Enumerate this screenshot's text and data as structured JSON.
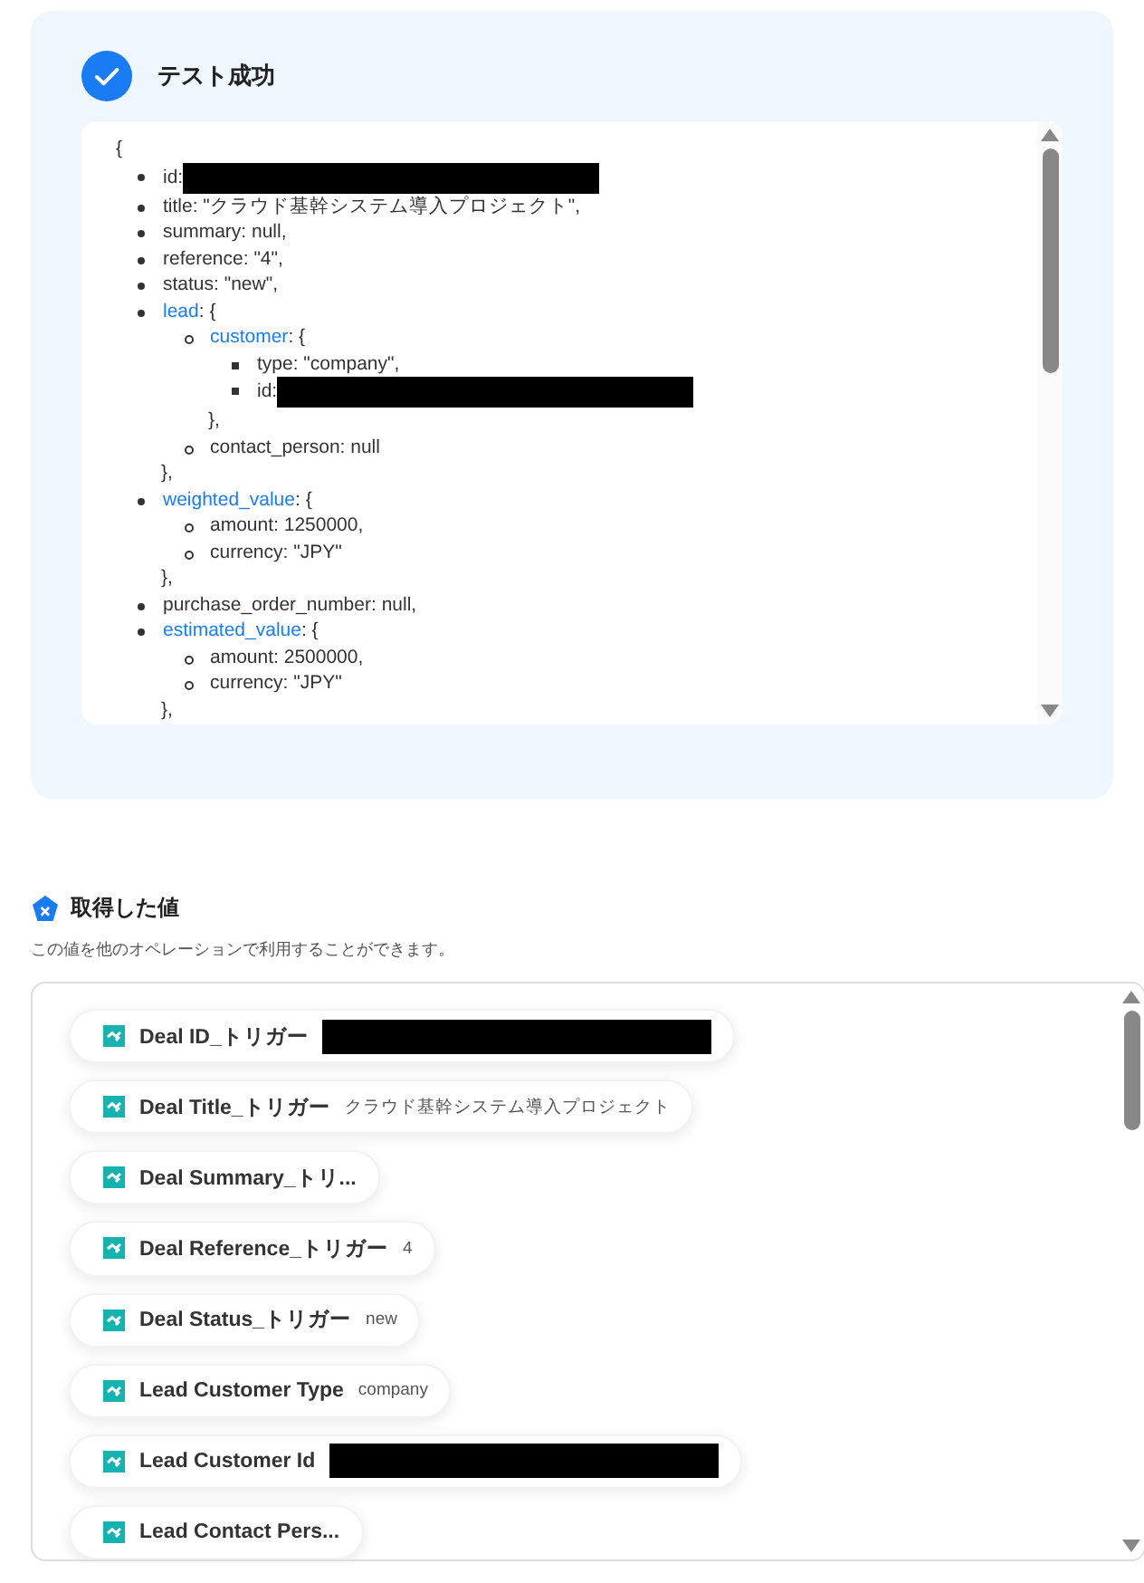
{
  "test_result": {
    "title": "テスト成功",
    "code": {
      "open": "{",
      "items": [
        {
          "label": "id:",
          "redacted": true
        },
        {
          "label": "title: \"クラウド基幹システム導入プロジェクト\","
        },
        {
          "label": "summary: null,"
        },
        {
          "label": "reference: \"4\","
        },
        {
          "label": "status: \"new\","
        },
        {
          "key": "lead",
          "suffix": ": {",
          "close": "},",
          "children": [
            {
              "key": "customer",
              "suffix": ": {",
              "close": "},",
              "children": [
                {
                  "label": "type: \"company\","
                },
                {
                  "label": "id:",
                  "redacted": true
                }
              ]
            },
            {
              "label": "contact_person: null"
            }
          ]
        },
        {
          "key": "weighted_value",
          "suffix": ": {",
          "close": "},",
          "children": [
            {
              "label": "amount: 1250000,"
            },
            {
              "label": "currency: \"JPY\""
            }
          ]
        },
        {
          "label": "purchase_order_number: null,"
        },
        {
          "key": "estimated_value",
          "suffix": ": {",
          "close": "},",
          "children": [
            {
              "label": "amount: 2500000,"
            },
            {
              "label": "currency: \"JPY\""
            }
          ]
        }
      ]
    }
  },
  "values": {
    "title": "取得した値",
    "description": "この値を他のオペレーションで利用することができます。",
    "items": [
      {
        "label": "Deal ID_トリガー",
        "redacted": true
      },
      {
        "label": "Deal Title_トリガー",
        "value": "クラウド基幹システム導入プロジェクト"
      },
      {
        "label": "Deal Summary_トリ..."
      },
      {
        "label": "Deal Reference_トリガー",
        "value": "4"
      },
      {
        "label": "Deal Status_トリガー",
        "value": "new"
      },
      {
        "label": "Lead Customer Type",
        "value": "company"
      },
      {
        "label": "Lead Customer Id",
        "redacted": true
      },
      {
        "label": "Lead Contact Pers..."
      }
    ]
  }
}
